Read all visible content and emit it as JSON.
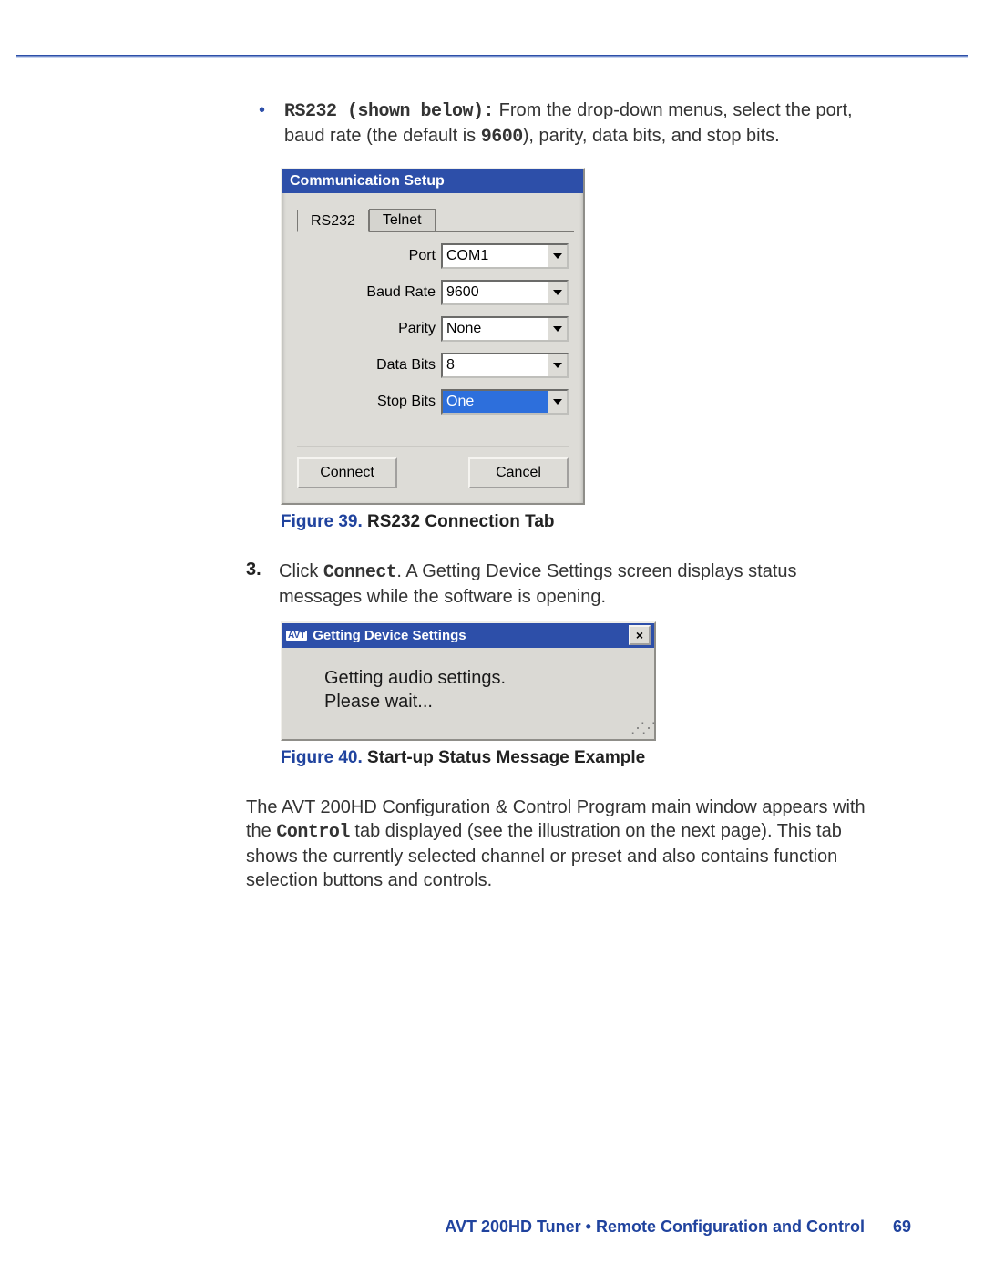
{
  "bullet": {
    "lead_strong": "RS232 (shown below):",
    "text_before_code": " From the drop-down menus, select the port, baud rate (the default is ",
    "code": "9600",
    "text_after_code": "), parity, data bits, and stop bits."
  },
  "panel": {
    "title": "Communication Setup",
    "tabs": {
      "active": "RS232",
      "inactive": "Telnet"
    },
    "rows": [
      {
        "label": "Port",
        "value": "COM1",
        "selected": false
      },
      {
        "label": "Baud Rate",
        "value": "9600",
        "selected": false
      },
      {
        "label": "Parity",
        "value": "None",
        "selected": false
      },
      {
        "label": "Data Bits",
        "value": "8",
        "selected": false
      },
      {
        "label": "Stop Bits",
        "value": "One",
        "selected": true
      }
    ],
    "buttons": {
      "connect": "Connect",
      "cancel": "Cancel"
    }
  },
  "fig39": {
    "label": "Figure 39.",
    "caption": " RS232 Connection Tab"
  },
  "step3": {
    "marker": "3.",
    "before_connect": "Click ",
    "connect_word": "Connect",
    "after_connect": ". A Getting Device Settings screen displays status messages while the software is opening."
  },
  "dialog": {
    "chip": "AVT",
    "title": "Getting Device Settings",
    "line1": "Getting audio settings.",
    "line2": "Please wait..."
  },
  "fig40": {
    "label": "Figure 40.",
    "caption": "  Start-up Status Message Example"
  },
  "paragraph": {
    "before_control": "The AVT 200HD Configuration & Control Program main window appears with the ",
    "control_word": "Control",
    "after_control": " tab displayed (see the illustration on the next page). This tab shows the currently selected channel or preset and also contains function selection buttons and controls."
  },
  "footer": {
    "title": "AVT 200HD Tuner • Remote Configuration and Control",
    "page": "69"
  }
}
